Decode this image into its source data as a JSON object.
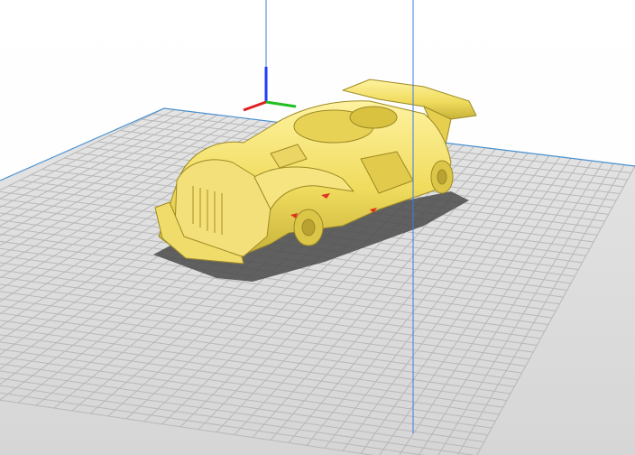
{
  "viewport": {
    "background_color": "#ffffff",
    "build_plate": {
      "fill_color": "#dcdcdc",
      "grid_line_color": "#b8b8b8",
      "edge_color": "#4a90d0",
      "shading": "grey"
    },
    "axes_gizmo": {
      "x_axis_color": "#e02020",
      "y_axis_color": "#20c020",
      "z_axis_color": "#1f3cff"
    },
    "build_volume_edge_color": "#3b7be6",
    "model": {
      "icon": "race-car-model",
      "color": "#f2de62",
      "shadow_color": "#4a4a4a",
      "overhang_highlight_color": "#e03020"
    }
  }
}
